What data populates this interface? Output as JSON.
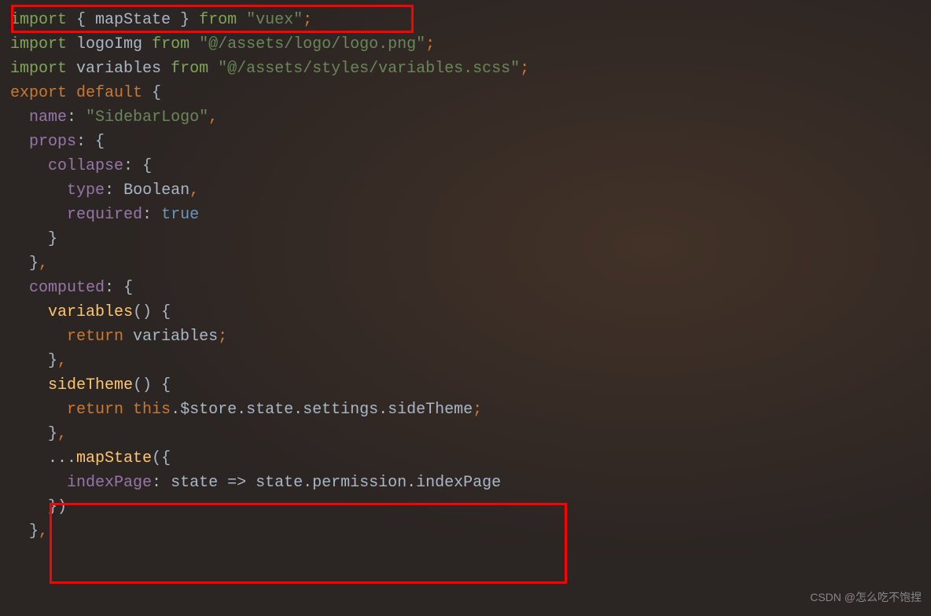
{
  "lines": {
    "l1_import": "import",
    "l1_brace_open": " { ",
    "l1_mapstate": "mapState",
    "l1_brace_close": " } ",
    "l1_from": "from",
    "l1_string": " \"vuex\"",
    "l1_semi": ";",
    "l2_import": "import",
    "l2_var": " logoImg ",
    "l2_from": "from",
    "l2_string": " \"@/assets/logo/logo.png\"",
    "l2_semi": ";",
    "l3_import": "import",
    "l3_var": " variables ",
    "l3_from": "from",
    "l3_string": " \"@/assets/styles/variables.scss\"",
    "l3_semi": ";",
    "l4_export": "export",
    "l4_default": " default",
    "l4_brace": " {",
    "l5_name": "  name",
    "l5_colon": ": ",
    "l5_string": "\"SidebarLogo\"",
    "l5_comma": ",",
    "l6_props": "  props",
    "l6_colon": ": ",
    "l6_brace": "{",
    "l7_collapse": "    collapse",
    "l7_colon": ": ",
    "l7_brace": "{",
    "l8_type": "      type",
    "l8_colon": ": ",
    "l8_boolean": "Boolean",
    "l8_comma": ",",
    "l9_required": "      required",
    "l9_colon": ": ",
    "l9_true": "true",
    "l10_brace": "    }",
    "l11_brace": "  }",
    "l11_comma": ",",
    "l12_computed": "  computed",
    "l12_colon": ": ",
    "l12_brace": "{",
    "l13_variables": "    variables",
    "l13_parens": "() ",
    "l13_brace": "{",
    "l14_return": "      return",
    "l14_var": " variables",
    "l14_semi": ";",
    "l15_brace": "    }",
    "l15_comma": ",",
    "l16_sidetheme": "    sideTheme",
    "l16_parens": "() ",
    "l16_brace": "{",
    "l17_return": "      return",
    "l17_this": " this",
    "l17_chain": ".$store.state.settings.sideTheme",
    "l17_semi": ";",
    "l18_brace": "    }",
    "l18_comma": ",",
    "l19_spread": "    ...",
    "l19_mapstate": "mapState",
    "l19_paren": "(",
    "l19_brace": "{",
    "l20_indexpage": "      indexPage",
    "l20_colon": ": ",
    "l20_state": "state",
    "l20_arrow": " => ",
    "l20_expr": "state.permission.indexPage",
    "l21_brace": "    }",
    "l21_paren": ")",
    "l22_brace": "  }",
    "l22_comma": ","
  },
  "watermark": "CSDN @怎么吃不饱捏"
}
